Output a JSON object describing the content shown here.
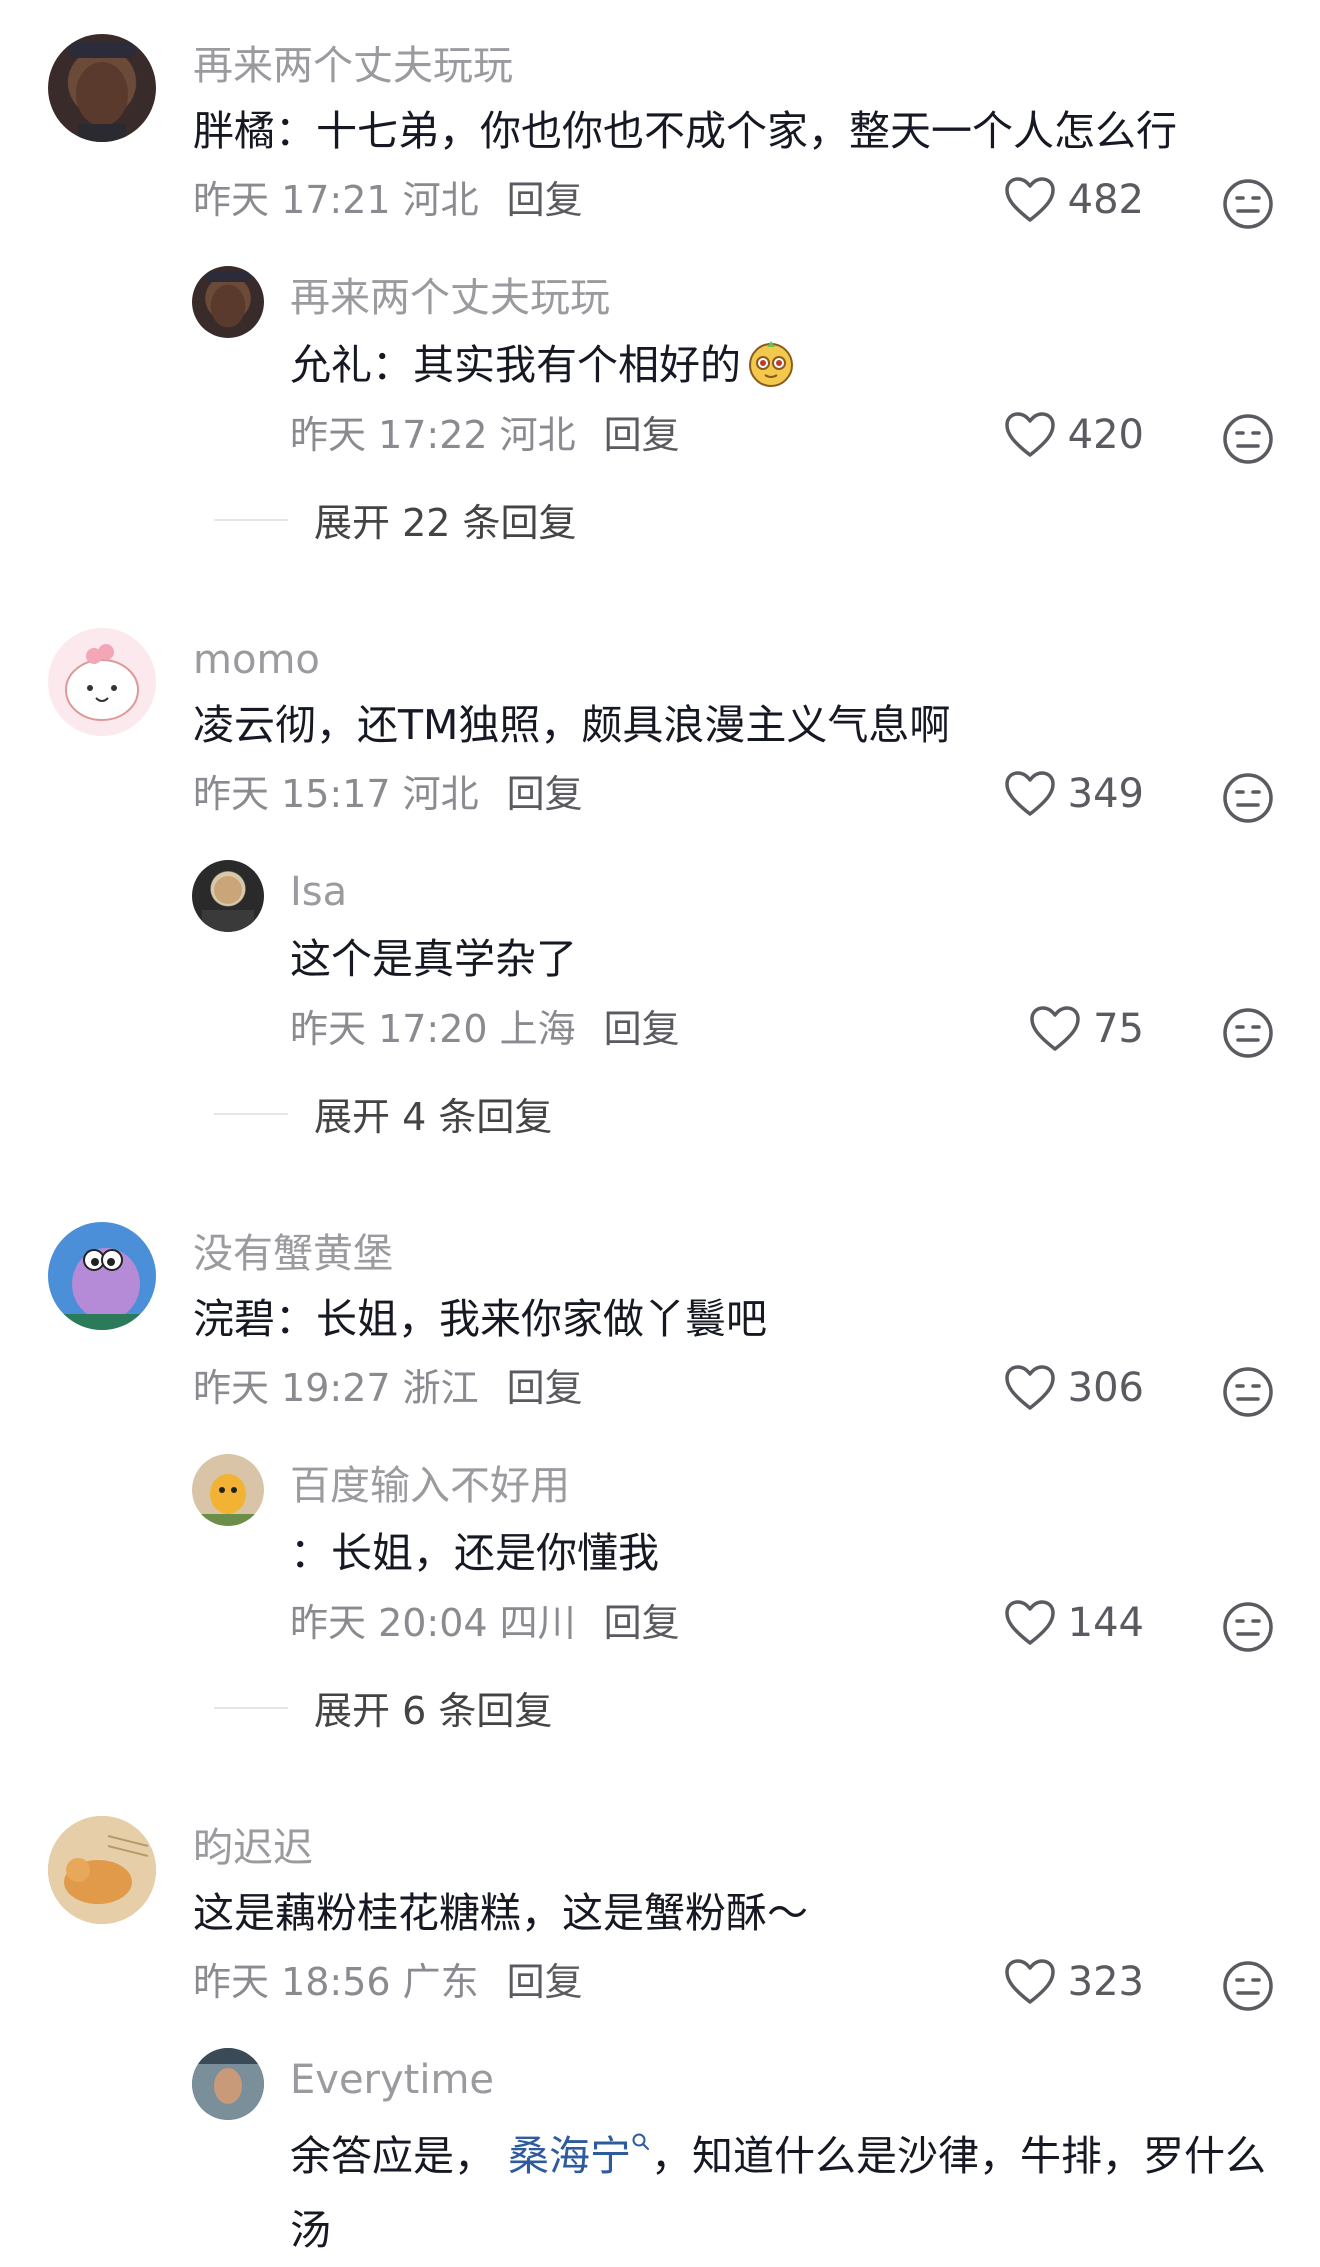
{
  "comments": [
    {
      "name": "再来两个丈夫玩玩",
      "text": "胖橘：十七弟，你也你也不成个家，整天一个人怎么行",
      "time": "昨天 17:21 河北",
      "reply_label": "回复",
      "likes": "482",
      "reply": {
        "name": "再来两个丈夫玩玩",
        "text": "允礼：其实我有个相好的",
        "time": "昨天 17:22 河北",
        "reply_label": "回复",
        "likes": "420"
      },
      "expand": "展开 22 条回复"
    },
    {
      "name": "momo",
      "text": "凌云彻，还TM独照，颇具浪漫主义气息啊",
      "time": "昨天 15:17 河北",
      "reply_label": "回复",
      "likes": "349",
      "reply": {
        "name": "Isa",
        "text": "这个是真学杂了",
        "time": "昨天 17:20 上海",
        "reply_label": "回复",
        "likes": "75"
      },
      "expand": "展开 4 条回复"
    },
    {
      "name": "没有蟹黄堡",
      "text": "浣碧：长姐，我来你家做丫鬟吧",
      "time": "昨天 19:27 浙江",
      "reply_label": "回复",
      "likes": "306",
      "reply": {
        "name": "百度输入不好用",
        "text": "：长姐，还是你懂我",
        "time": "昨天 20:04 四川",
        "reply_label": "回复",
        "likes": "144"
      },
      "expand": "展开 6 条回复"
    },
    {
      "name": "昀迟迟",
      "text": "这是藕粉桂花糖糕，这是蟹粉酥～",
      "time": "昨天 18:56 广东",
      "reply_label": "回复",
      "likes": "323",
      "reply": {
        "name": "Everytime",
        "text_before": "余答应是，",
        "mention": "桑海宁",
        "text_after": "，知道什么是沙律，牛排，罗什么汤"
      }
    }
  ],
  "icons": {
    "like": "heart-outline-icon",
    "dislike": "neutral-face-icon",
    "emoji": "monkey-emoji-icon",
    "mention_search": "search-icon"
  },
  "colors": {
    "text": "#161823",
    "meta": "#8a8a90",
    "mention": "#2e5b9e"
  }
}
